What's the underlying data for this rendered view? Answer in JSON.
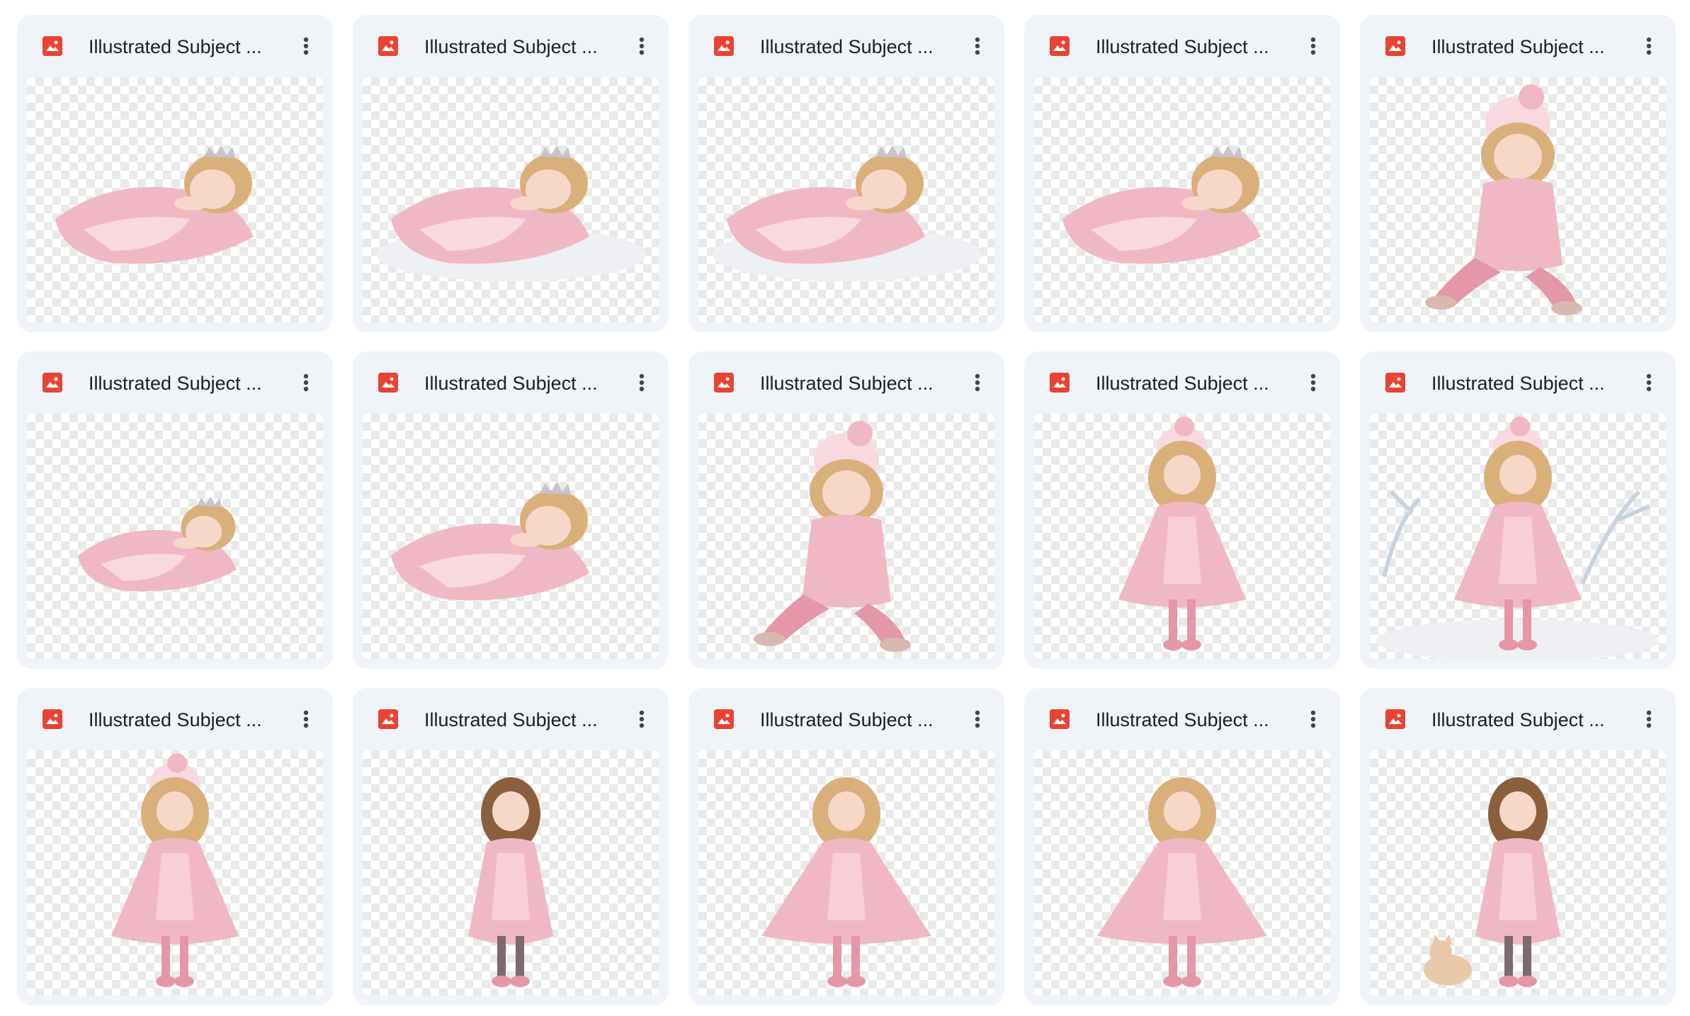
{
  "colors": {
    "card_background": "#f0f4f9",
    "image_file_icon": "#ea4335",
    "title_text": "#1f1f1f",
    "more_icon": "#444746"
  },
  "files": [
    {
      "title": "Illustrated Subject ...",
      "icon": "image-file-icon",
      "thumbnail": "sleeping-princess-pink-dress"
    },
    {
      "title": "Illustrated Subject ...",
      "icon": "image-file-icon",
      "thumbnail": "sleeping-princess-on-cloud"
    },
    {
      "title": "Illustrated Subject ...",
      "icon": "image-file-icon",
      "thumbnail": "sleeping-princess-on-cloud"
    },
    {
      "title": "Illustrated Subject ...",
      "icon": "image-file-icon",
      "thumbnail": "sleeping-princess-pink-dress"
    },
    {
      "title": "Illustrated Subject ...",
      "icon": "image-file-icon",
      "thumbnail": "sitting-girl-pink-hat"
    },
    {
      "title": "Illustrated Subject ...",
      "icon": "image-file-icon",
      "thumbnail": "sleeping-princess-small"
    },
    {
      "title": "Illustrated Subject ...",
      "icon": "image-file-icon",
      "thumbnail": "sleeping-princess-pink-dress"
    },
    {
      "title": "Illustrated Subject ...",
      "icon": "image-file-icon",
      "thumbnail": "sitting-girl-pink-hat"
    },
    {
      "title": "Illustrated Subject ...",
      "icon": "image-file-icon",
      "thumbnail": "standing-girl-pink-coat"
    },
    {
      "title": "Illustrated Subject ...",
      "icon": "image-file-icon",
      "thumbnail": "standing-girl-snowy-trees"
    },
    {
      "title": "Illustrated Subject ...",
      "icon": "image-file-icon",
      "thumbnail": "standing-girl-pink-coat"
    },
    {
      "title": "Illustrated Subject ...",
      "icon": "image-file-icon",
      "thumbnail": "walking-girl-brown-hair"
    },
    {
      "title": "Illustrated Subject ...",
      "icon": "image-file-icon",
      "thumbnail": "dancing-girl-blonde"
    },
    {
      "title": "Illustrated Subject ...",
      "icon": "image-file-icon",
      "thumbnail": "dancing-girl-blonde"
    },
    {
      "title": "Illustrated Subject ...",
      "icon": "image-file-icon",
      "thumbnail": "walking-girl-with-cat"
    }
  ]
}
